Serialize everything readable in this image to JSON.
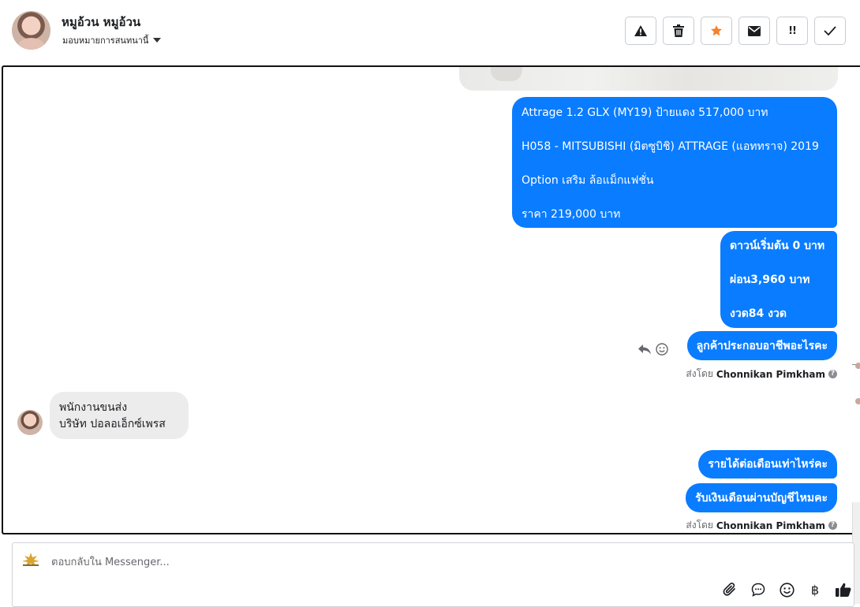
{
  "header": {
    "contact_name": "หมูอ้วน หมูอ้วน",
    "assign_label": "มอบหมายการสนทนานี้",
    "toolbar": [
      {
        "name": "warning-button",
        "icon": "warning-icon"
      },
      {
        "name": "delete-button",
        "icon": "trash-icon"
      },
      {
        "name": "star-button",
        "icon": "star-icon",
        "color": "#f5822a"
      },
      {
        "name": "mail-button",
        "icon": "envelope-icon"
      },
      {
        "name": "priority-button",
        "icon": "priority-icon",
        "text": "!!"
      },
      {
        "name": "done-button",
        "icon": "check-icon"
      }
    ]
  },
  "messages": {
    "car_info": {
      "line1": "Attrage 1.2 GLX (MY19) ป้ายแดง 517,000 บาท",
      "line2": "H058 - MITSUBISHI (มิตซูบิชิ) ATTRAGE (แอททราจ) 2019",
      "line3": " Option เสริม ล้อแม็กแฟชั่น",
      "line4": "ราคา 219,000 บาท"
    },
    "finance": {
      "line1": "ดาวน์เริ่มต้น 0 บาท",
      "line2": "ผ่อน3,960 บาท",
      "line3": "งวด84 งวด"
    },
    "ask_job": "ลูกค้าประกอบอาชีพอะไรคะ",
    "sent_by_1": {
      "prefix": "ส่งโดย",
      "agent": "Chonnikan Pimkham"
    },
    "customer_reply": {
      "line1": "พนักงานขนส่ง",
      "line2": "บริษัท ปอลอเอ็กซ์เพรส"
    },
    "ask_income": "รายได้ต่อเดือนเท่าไหร่คะ",
    "ask_salary_account": "รับเงินเดือนผ่านบัญชีไหมคะ",
    "sent_by_2": {
      "prefix": "ส่งโดย",
      "agent": "Chonnikan Pimkham"
    }
  },
  "composer": {
    "placeholder": "ตอบกลับใน Messenger...",
    "tools": [
      "paperclip-icon",
      "chat-bubble-icon",
      "smiley-icon",
      "baht-icon",
      "thumbs-up-icon"
    ],
    "baht_symbol": "฿"
  },
  "colors": {
    "outgoing_bubble": "#0a7cff",
    "incoming_bubble": "#ececec",
    "star": "#f5822a"
  }
}
